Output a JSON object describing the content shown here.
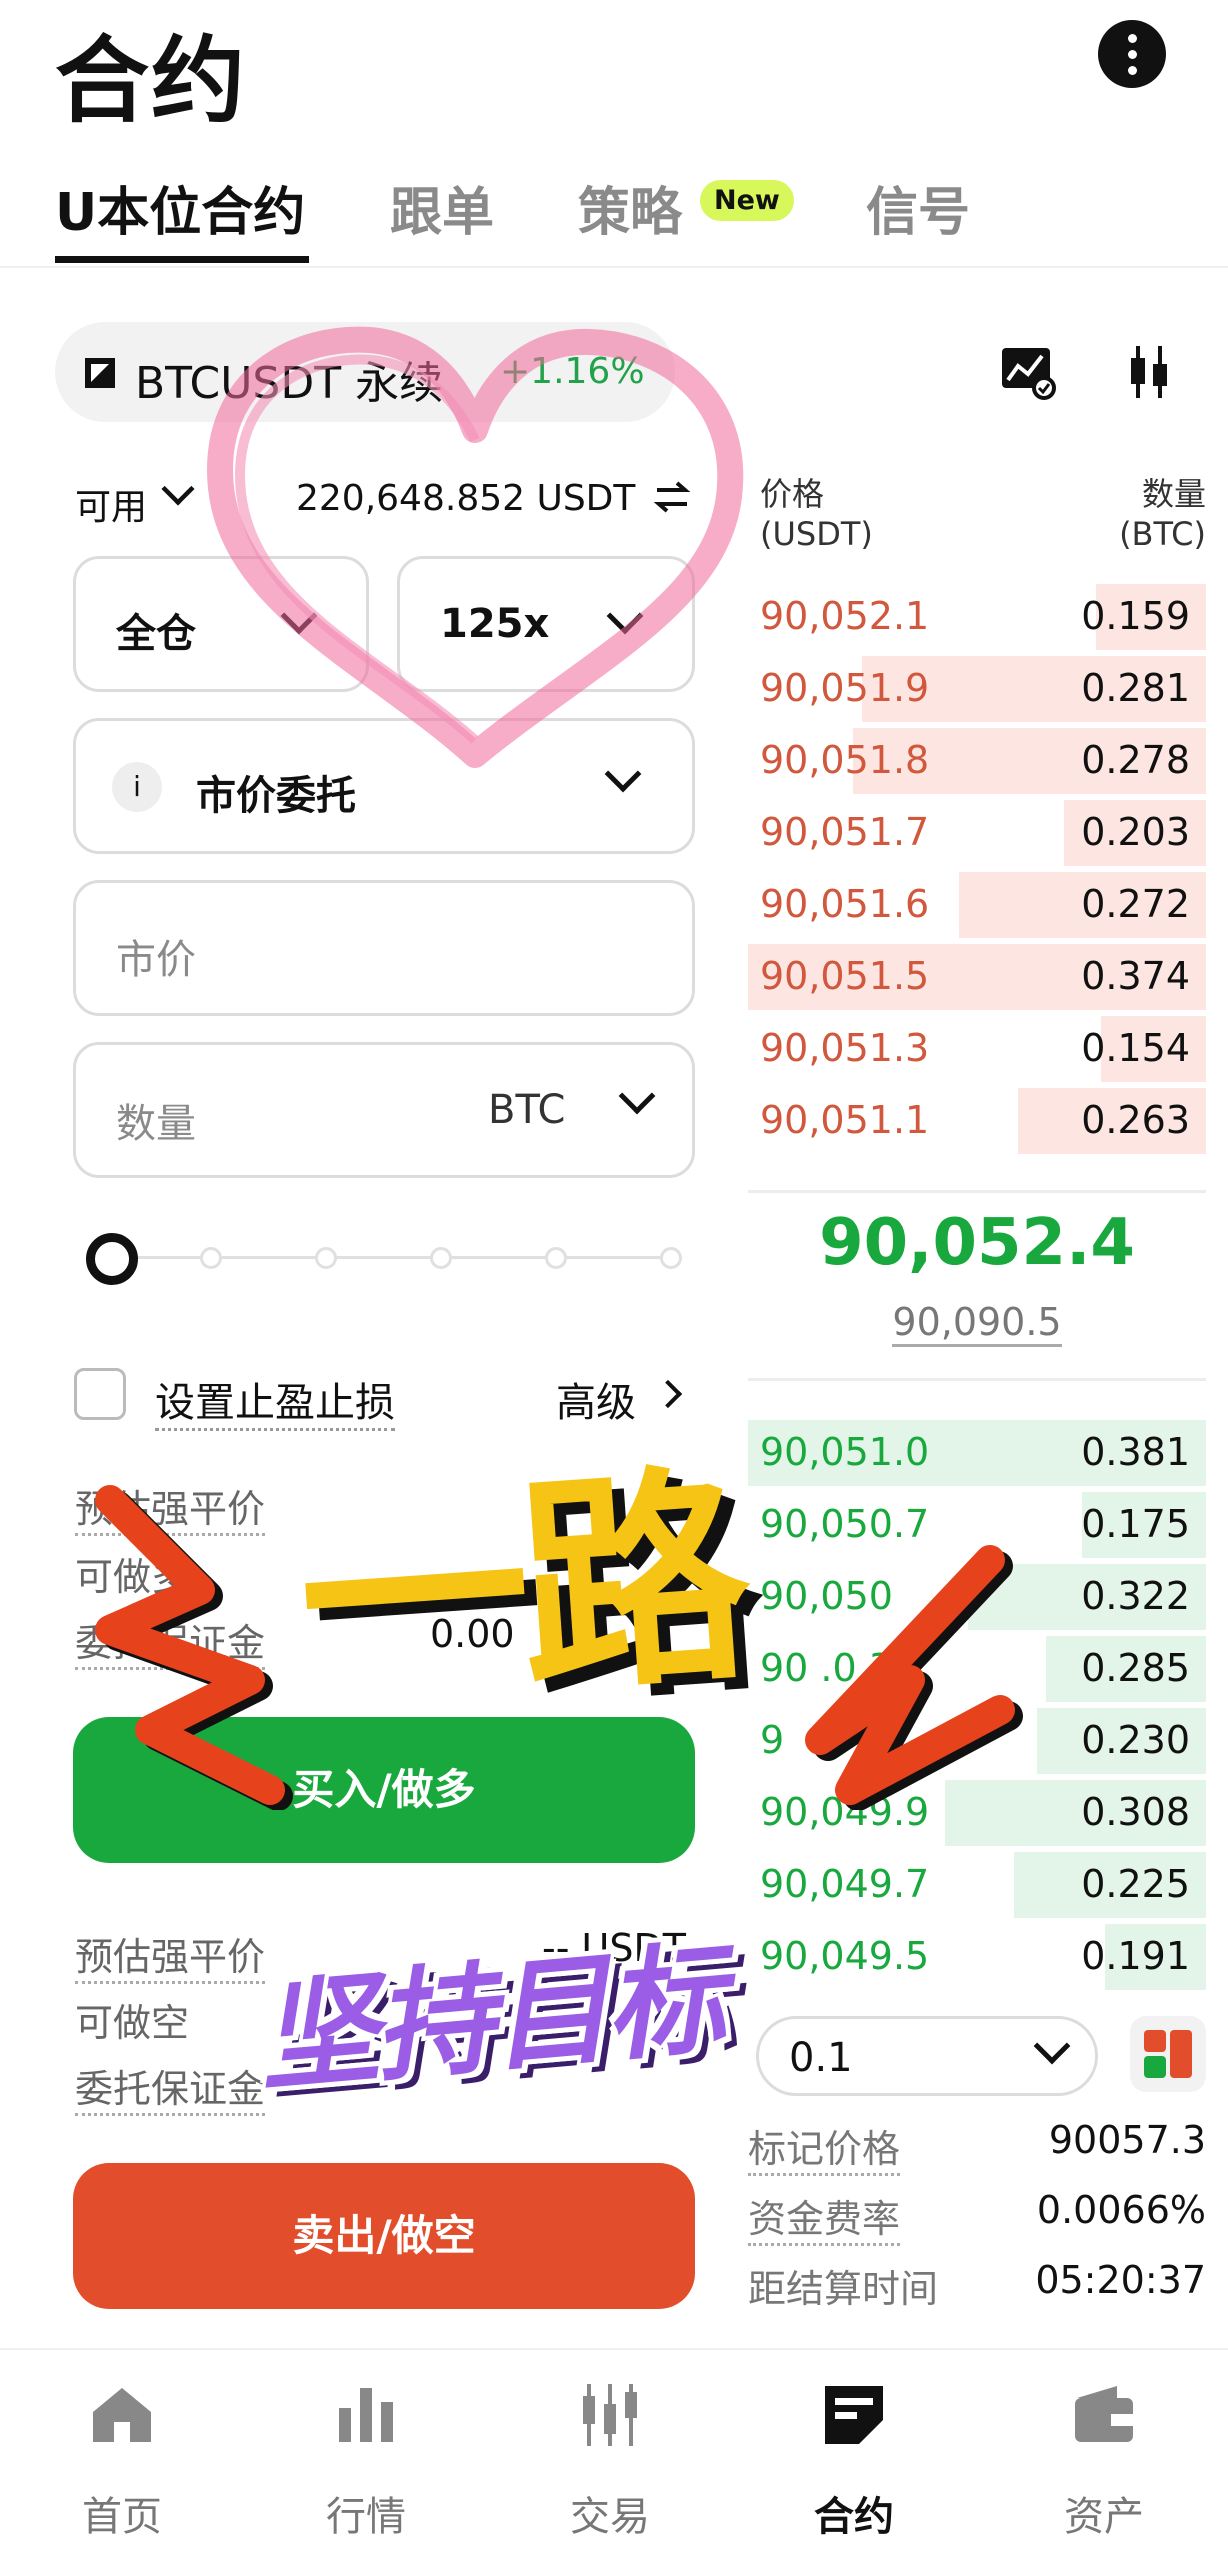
{
  "header": {
    "title": "合约"
  },
  "tabs": [
    {
      "label": "U本位合约",
      "active": true
    },
    {
      "label": "跟单"
    },
    {
      "label": "策略",
      "badge": "New"
    },
    {
      "label": "信号"
    }
  ],
  "ticker": {
    "symbol": "BTCUSDT 永续",
    "change": "+1.16%"
  },
  "order_form": {
    "available_label": "可用",
    "available_value": "220,648.852 USDT",
    "margin_mode": "全仓",
    "leverage": "125x",
    "order_type": "市价委托",
    "info_icon": "i",
    "price_placeholder": "市价",
    "qty_placeholder": "数量",
    "qty_unit": "BTC",
    "slider_fraction": 0,
    "tpsl_label": "设置止盈止损",
    "advanced_label": "高级",
    "buy_info": [
      {
        "label": "预估强平价",
        "value": ""
      },
      {
        "label": "可做多",
        "value": ""
      },
      {
        "label": "委托保证金",
        "value": "0.00"
      }
    ],
    "buy_button": "买入/做多",
    "sell_info": [
      {
        "label": "预估强平价",
        "value": "-- USDT"
      },
      {
        "label": "可做空",
        "value": ""
      },
      {
        "label": "委托保证金",
        "value": ""
      }
    ],
    "sell_button": "卖出/做空"
  },
  "order_book": {
    "price_header": "价格\n(USDT)",
    "qty_header": "数量\n(BTC)",
    "asks": [
      {
        "price": "90,052.1",
        "qty": "0.159",
        "depth": 0.24
      },
      {
        "price": "90,051.9",
        "qty": "0.281",
        "depth": 0.75
      },
      {
        "price": "90,051.8",
        "qty": "0.278",
        "depth": 0.77
      },
      {
        "price": "90,051.7",
        "qty": "0.203",
        "depth": 0.31
      },
      {
        "price": "90,051.6",
        "qty": "0.272",
        "depth": 0.54
      },
      {
        "price": "90,051.5",
        "qty": "0.374",
        "depth": 1.0
      },
      {
        "price": "90,051.3",
        "qty": "0.154",
        "depth": 0.23
      },
      {
        "price": "90,051.1",
        "qty": "0.263",
        "depth": 0.41
      }
    ],
    "last_price": "90,052.4",
    "mark_price": "90,090.5",
    "bids": [
      {
        "price": "90,051.0",
        "qty": "0.381",
        "depth": 1.0
      },
      {
        "price": "90,050.7",
        "qty": "0.175",
        "depth": 0.27
      },
      {
        "price": "90,050",
        "qty": "0.322",
        "depth": 0.52
      },
      {
        "price": "90 .0.3",
        "qty": "0.285",
        "depth": 0.35
      },
      {
        "price": "9",
        "qty": "0.230",
        "depth": 0.37
      },
      {
        "price": "90,049.9",
        "qty": "0.308",
        "depth": 0.57
      },
      {
        "price": "90,049.7",
        "qty": "0.225",
        "depth": 0.42
      },
      {
        "price": "90,049.5",
        "qty": "0.191",
        "depth": 0.22
      }
    ],
    "depth_step": "0.1"
  },
  "stats": [
    {
      "label": "标记价格",
      "value": "90057.3"
    },
    {
      "label": "资金费率",
      "value": "0.0066%"
    },
    {
      "label": "距结算时间",
      "value": "05:20:37"
    }
  ],
  "bottom_nav": [
    {
      "label": "首页",
      "icon": "home-icon"
    },
    {
      "label": "行情",
      "icon": "bar-chart-icon"
    },
    {
      "label": "交易",
      "icon": "candlestick-icon"
    },
    {
      "label": "合约",
      "icon": "contract-icon",
      "active": true
    },
    {
      "label": "资产",
      "icon": "wallet-icon"
    }
  ],
  "overlay": {
    "sticker_top": "一路",
    "sticker_bottom": "坚持目标"
  },
  "colors": {
    "buy": "#19a83d",
    "sell": "#e24d2b",
    "ask_text": "#d1573d",
    "new_badge": "#d8f75b",
    "sticker_yellow": "#f6c414",
    "sticker_purple": "#9b5de5"
  }
}
